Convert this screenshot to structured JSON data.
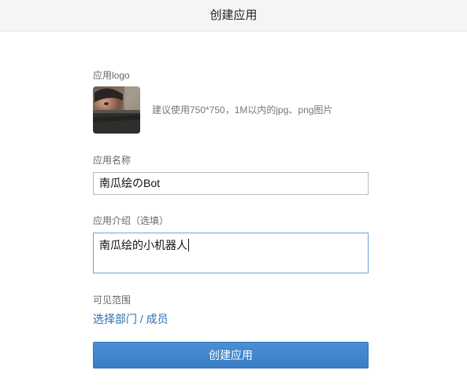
{
  "header": {
    "title": "创建应用"
  },
  "logo": {
    "label": "应用logo",
    "hint": "建议使用750*750，1M以内的jpg、png图片",
    "icon": "app-logo-photo"
  },
  "name_field": {
    "label": "应用名称",
    "value": "南瓜绘のBot"
  },
  "desc_field": {
    "label": "应用介绍（选填）",
    "value": "南瓜绘的小机器人"
  },
  "visibility": {
    "label": "可见范围",
    "link": "选择部门 / 成员"
  },
  "submit": {
    "label": "创建应用"
  },
  "colors": {
    "accent": "#3a7ec4",
    "link": "#2d6eab",
    "header_bg": "#f5f5f5"
  }
}
